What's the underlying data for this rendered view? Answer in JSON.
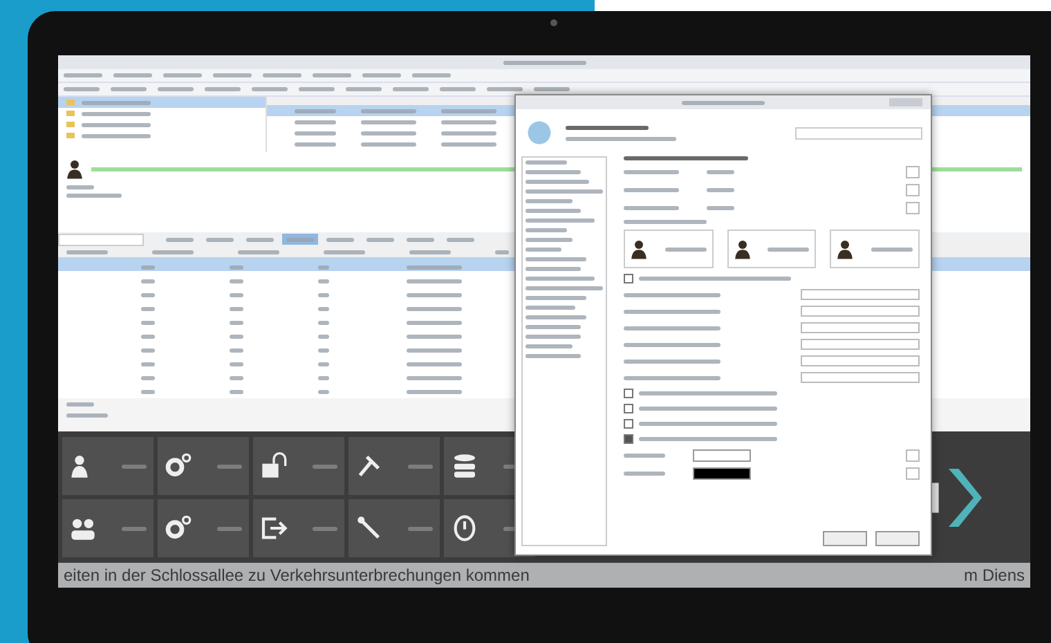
{
  "main_window": {
    "tree_rows": [
      {
        "selected": true
      },
      {
        "selected": false
      },
      {
        "selected": false
      },
      {
        "selected": false
      }
    ],
    "list_rows": [
      {
        "selected": true
      },
      {
        "selected": false
      },
      {
        "selected": false
      },
      {
        "selected": false
      }
    ],
    "progress": {
      "level": 1
    },
    "tabs": [
      {
        "selected": false
      },
      {
        "selected": false
      },
      {
        "selected": false
      },
      {
        "selected": true
      },
      {
        "selected": false
      },
      {
        "selected": false
      },
      {
        "selected": false
      },
      {
        "selected": false
      }
    ],
    "table_rows": [
      {
        "selected": true
      },
      {
        "selected": false
      },
      {
        "selected": false
      },
      {
        "selected": false
      },
      {
        "selected": false
      },
      {
        "selected": false
      },
      {
        "selected": false
      },
      {
        "selected": false
      },
      {
        "selected": false
      },
      {
        "selected": false
      }
    ]
  },
  "tiles": [
    {
      "kind": "person"
    },
    {
      "kind": "gears"
    },
    {
      "kind": "lock"
    },
    {
      "kind": "tools"
    },
    {
      "kind": "database"
    },
    {
      "kind": "group"
    },
    {
      "kind": "gears"
    },
    {
      "kind": "exit"
    },
    {
      "kind": "pin"
    },
    {
      "kind": "power"
    }
  ],
  "ticker": {
    "text": "eiten in der Schlossallee zu Verkehrsunterbrechungen kommen",
    "text_right": "m Diens"
  },
  "dialog": {
    "avatars": [
      {
        "kind": "person"
      },
      {
        "kind": "person"
      },
      {
        "kind": "person"
      }
    ],
    "avatar_checkbox": {
      "checked": false
    },
    "checkboxes": [
      {
        "checked": false
      },
      {
        "checked": false
      },
      {
        "checked": false
      },
      {
        "checked": true
      }
    ],
    "swatches": [
      {
        "color": "#ffffff"
      },
      {
        "color": "#000000"
      }
    ]
  }
}
